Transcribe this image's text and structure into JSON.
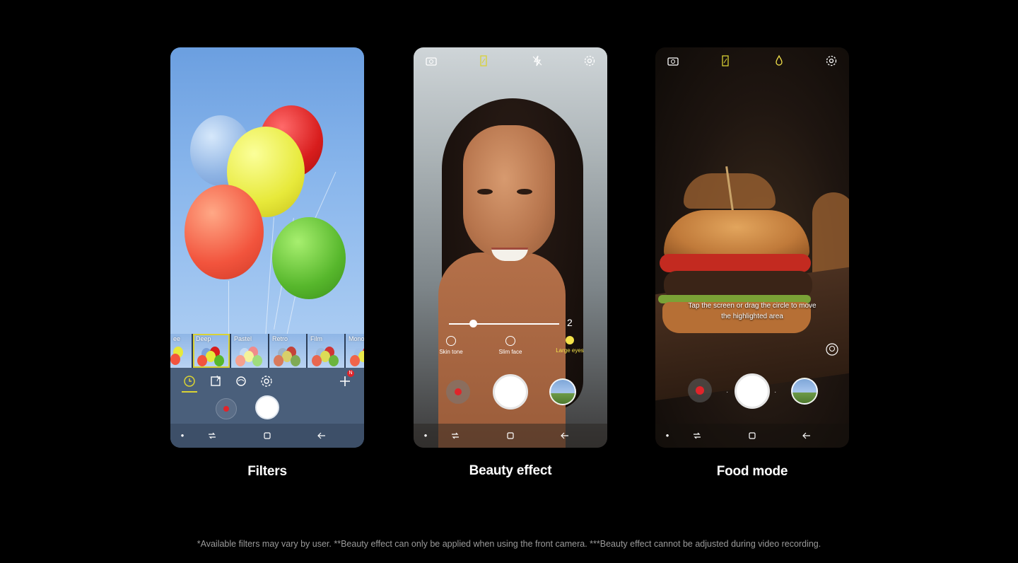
{
  "phones": [
    {
      "caption": "Filters",
      "filters": [
        "ee",
        "Deep",
        "Pastel",
        "Retro",
        "Film",
        "Mono"
      ],
      "selected_filter": "Deep",
      "add_badge": "N"
    },
    {
      "caption": "Beauty effect",
      "slider_value": "2",
      "options": [
        "Skin tone",
        "Slim face",
        "Large eyes"
      ],
      "active_option": "Large eyes"
    },
    {
      "caption": "Food mode",
      "hint_line1": "Tap the screen or drag the circle to move",
      "hint_line2": "the highlighted area"
    }
  ],
  "footnote": "*Available filters may vary by user. **Beauty effect can only be applied when using the front camera. ***Beauty effect cannot be adjusted during video recording.",
  "colors": {
    "background": "#000000",
    "accent_yellow": "#d9d234",
    "record_red": "#e0242a"
  },
  "icons": [
    "switch-camera-icon",
    "aspect-ratio-icon",
    "flash-off-icon",
    "settings-icon",
    "timer-icon",
    "sticker-icon",
    "effects-icon",
    "add-icon",
    "recent-apps-icon",
    "home-icon",
    "back-icon",
    "food-drop-icon",
    "color-tune-icon"
  ]
}
